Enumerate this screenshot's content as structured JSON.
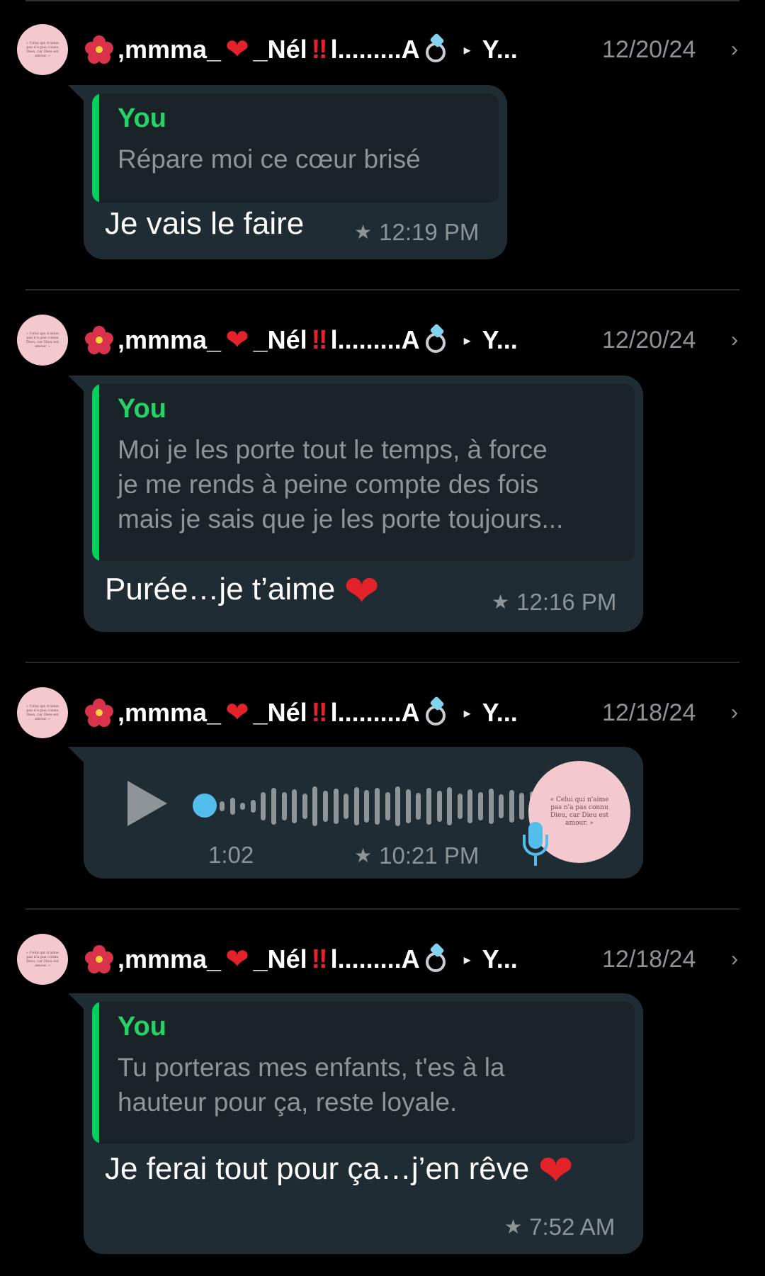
{
  "sender_display": {
    "name_part1": ",mmma_",
    "name_part2": "_Nél",
    "bang": "‼",
    "name_part3": "l.........A",
    "recipient": "Y...",
    "avatar_caption": "« Celui qui n'aime pas n'a pas connu Dieu, car Dieu est amour. »"
  },
  "icons": {
    "avatar": "avatar-image",
    "flower": "hibiscus-emoji",
    "heart": "red-heart-emoji",
    "ring": "ring-emoji",
    "arrow": "play-right-arrow-icon",
    "chevron": "chevron-right-icon",
    "star": "star-icon",
    "play": "play-icon",
    "mic": "microphone-icon"
  },
  "colors": {
    "background": "#000000",
    "bubble": "#202c33",
    "quote_bar": "#06cf5c",
    "quote_name": "#25d366",
    "accent_blue": "#53bdeb",
    "heart": "#e3222a"
  },
  "entries": [
    {
      "date": "12/20/24",
      "quote_author": "You",
      "quote_lines": [
        "Répare moi ce cœur brisé"
      ],
      "message": "Je vais le faire",
      "time": "12:19 PM"
    },
    {
      "date": "12/20/24",
      "quote_author": "You",
      "quote_lines": [
        "Moi je les porte tout le temps, à force",
        "je me rends à peine compte des fois",
        "mais je sais que je les porte toujours..."
      ],
      "message": "Purée…je t’aime",
      "time": "12:16 PM"
    },
    {
      "date": "12/18/24",
      "voice_duration": "1:02",
      "time": "10:21 PM",
      "voice_progress": 0
    },
    {
      "date": "12/18/24",
      "quote_author": "You",
      "quote_lines": [
        "Tu porteras mes enfants, t'es à la",
        "hauteur pour ça, reste loyale."
      ],
      "message": "Je ferai tout pour ça…j’en rêve",
      "time": "7:52 AM"
    }
  ]
}
